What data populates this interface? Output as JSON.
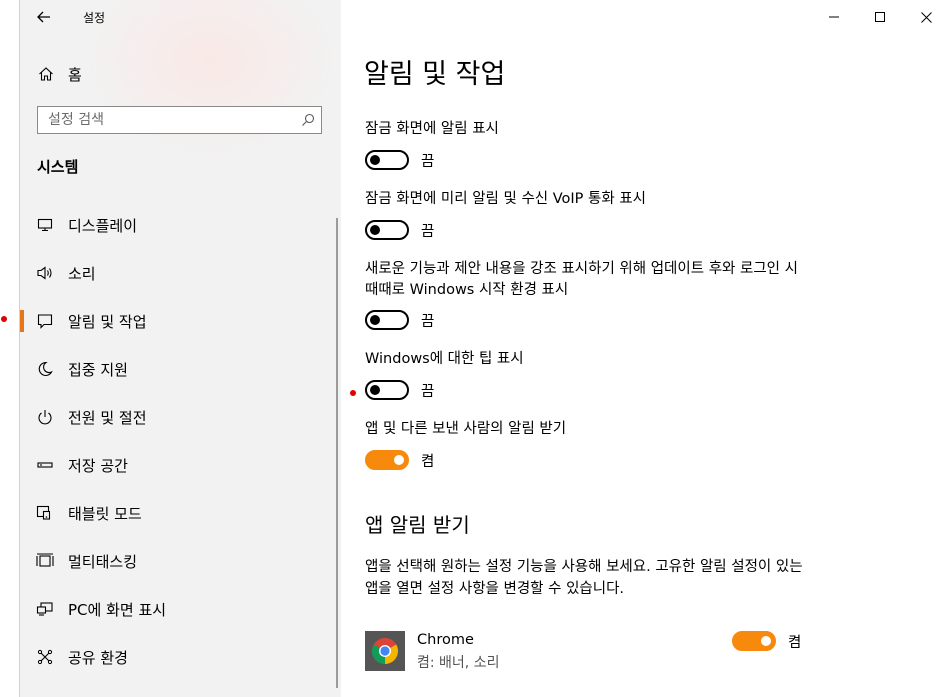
{
  "window": {
    "title": "설정"
  },
  "sidebar": {
    "home_label": "홈",
    "search_placeholder": "설정 검색",
    "section_title": "시스템",
    "items": [
      {
        "label": "디스플레이",
        "icon": "monitor-icon"
      },
      {
        "label": "소리",
        "icon": "speaker-icon"
      },
      {
        "label": "알림 및 작업",
        "icon": "notification-icon",
        "active": true
      },
      {
        "label": "집중 지원",
        "icon": "moon-icon"
      },
      {
        "label": "전원 및 절전",
        "icon": "power-icon"
      },
      {
        "label": "저장 공간",
        "icon": "storage-icon"
      },
      {
        "label": "태블릿 모드",
        "icon": "tablet-mode-icon"
      },
      {
        "label": "멀티태스킹",
        "icon": "multitasking-icon"
      },
      {
        "label": "PC에 화면 표시",
        "icon": "project-icon"
      },
      {
        "label": "공유 환경",
        "icon": "shared-experiences-icon"
      }
    ]
  },
  "main": {
    "title": "알림 및 작업",
    "settings": [
      {
        "label": "잠금 화면에 알림 표시",
        "state": "끔",
        "on": false
      },
      {
        "label": "잠금 화면에 미리 알림 및 수신 VoIP 통화 표시",
        "state": "끔",
        "on": false
      },
      {
        "label": "새로운 기능과 제안 내용을 강조 표시하기 위해 업데이트 후와 로그인 시 때때로 Windows 시작 환경 표시",
        "state": "끔",
        "on": false
      },
      {
        "label": "Windows에 대한 팁 표시",
        "state": "끔",
        "on": false
      },
      {
        "label": "앱 및 다른 보낸 사람의 알림 받기",
        "state": "켬",
        "on": true
      }
    ],
    "section_head": "앱 알림 받기",
    "description": "앱을 선택해 원하는 설정 기능을 사용해 보세요. 고유한 알림 설정이 있는 앱을 열면 설정 사항을 변경할 수 있습니다.",
    "apps": [
      {
        "name": "Chrome",
        "sub": "켬: 배너, 소리",
        "state": "켬",
        "on": true
      }
    ]
  },
  "colors": {
    "accent": "#f7890c",
    "active_bar": "#e3771a",
    "sidebar_bg": "#f2f2f2"
  }
}
